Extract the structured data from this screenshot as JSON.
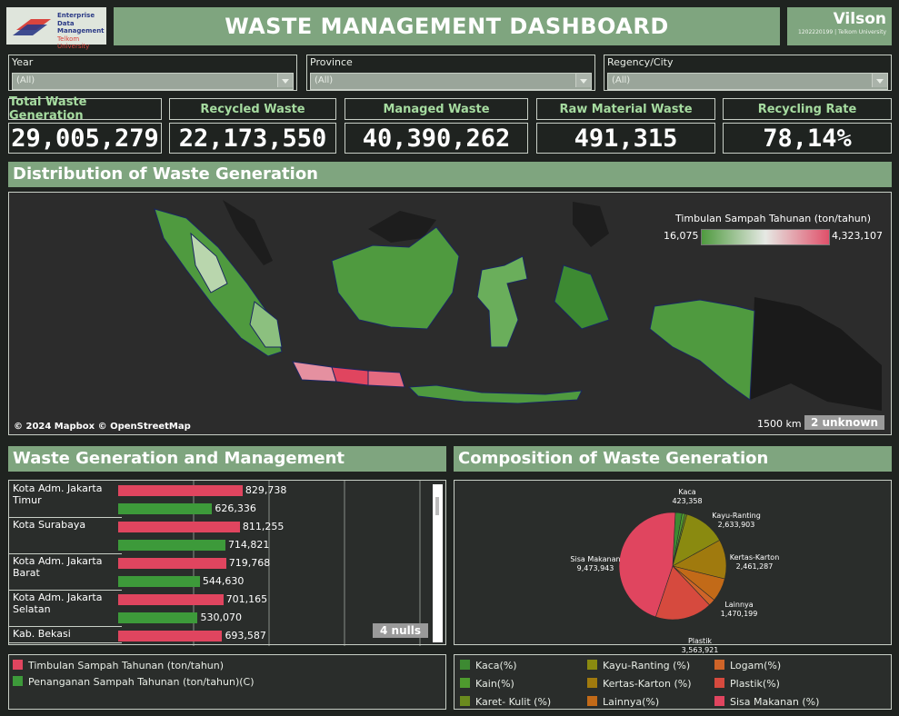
{
  "header": {
    "logo_lines": [
      "Enterprise",
      "Data",
      "Management"
    ],
    "logo_sub": "Telkom University",
    "title": "WASTE MANAGEMENT DASHBOARD",
    "user_name": "Vilson",
    "user_id": "1202220199 | Telkom University"
  },
  "filters": [
    {
      "label": "Year",
      "value": "(All)"
    },
    {
      "label": "Province",
      "value": "(All)"
    },
    {
      "label": "Regency/City",
      "value": "(All)"
    }
  ],
  "kpis": [
    {
      "label": "Total Waste Generation",
      "value": "29,005,279"
    },
    {
      "label": "Recycled Waste",
      "value": "22,173,550"
    },
    {
      "label": "Managed Waste",
      "value": "40,390,262"
    },
    {
      "label": "Raw Material Waste",
      "value": "491,315"
    },
    {
      "label": "Recycling Rate",
      "value": "78,14%"
    }
  ],
  "map_section": {
    "title": "Distribution of Waste Generation",
    "legend_title": "Timbulan Sampah Tahunan (ton/tahun)",
    "legend_min": "16,075",
    "legend_max": "4,323,107",
    "copyright": "© 2024 Mapbox © OpenStreetMap",
    "scale_label": "1500 km",
    "unknown_badge": "2 unknown",
    "colors": {
      "low": "#4f9a3f",
      "mid": "#e6e9e4",
      "high": "#e0506a"
    }
  },
  "bars_section": {
    "title": "Waste Generation and Management",
    "nulls_badge": "4 nulls",
    "legend": [
      {
        "label": "Timbulan Sampah Tahunan (ton/tahun)",
        "color": "#e0455f"
      },
      {
        "label": "Penanganan Sampah Tahunan (ton/tahun)(C)",
        "color": "#3d9a3a"
      }
    ]
  },
  "chart_data": [
    {
      "type": "bar",
      "categories": [
        "Kota Adm. Jakarta Timur",
        "Kota Surabaya",
        "Kota Adm. Jakarta Barat",
        "Kota Adm. Jakarta Selatan",
        "Kab. Bekasi"
      ],
      "series": [
        {
          "name": "Timbulan Sampah Tahunan (ton/tahun)",
          "values": [
            829738,
            811255,
            719768,
            701165,
            693587
          ],
          "labels": [
            "829,738",
            "811,255",
            "719,768",
            "701,165",
            "693,587"
          ]
        },
        {
          "name": "Penanganan Sampah Tahunan (ton/tahun)(C)",
          "values": [
            626336,
            714821,
            544630,
            530070,
            null
          ],
          "labels": [
            "626,336",
            "714,821",
            "544,630",
            "530,070",
            ""
          ]
        }
      ],
      "orientation": "horizontal"
    },
    {
      "type": "pie",
      "title": "Composition of Waste Generation",
      "slices": [
        {
          "name": "Kaca",
          "value": 423358,
          "label": "423,358",
          "color": "#3d8a32"
        },
        {
          "name": "Kain",
          "value": 180000,
          "label": "",
          "color": "#4e9a2e"
        },
        {
          "name": "Karet- Kulit",
          "value": 120000,
          "label": "",
          "color": "#6a8a1e"
        },
        {
          "name": "Kayu-Ranting",
          "value": 2633903,
          "label": "2,633,903",
          "color": "#8a8a10"
        },
        {
          "name": "Kertas-Karton",
          "value": 2461287,
          "label": "2,461,287",
          "color": "#a07a0e"
        },
        {
          "name": "Lainnya",
          "value": 1470199,
          "label": "1,470,199",
          "color": "#c26a18"
        },
        {
          "name": "Logam",
          "value": 420000,
          "label": "",
          "color": "#cf6428"
        },
        {
          "name": "Plastik",
          "value": 3563921,
          "label": "3,563,921",
          "color": "#d64a3e"
        },
        {
          "name": "Sisa Makanan",
          "value": 9473943,
          "label": "9,473,943",
          "color": "#e0455f"
        }
      ]
    }
  ],
  "pie_section": {
    "title": "Composition of Waste Generation",
    "legend": [
      {
        "label": "Kaca(%)",
        "color": "#3d8a32"
      },
      {
        "label": "Kayu-Ranting (%)",
        "color": "#8a8a10"
      },
      {
        "label": "Logam(%)",
        "color": "#cf6428"
      },
      {
        "label": "Kain(%)",
        "color": "#4e9a2e"
      },
      {
        "label": "Kertas-Karton (%)",
        "color": "#a07a0e"
      },
      {
        "label": "Plastik(%)",
        "color": "#d64a3e"
      },
      {
        "label": "Karet- Kulit (%)",
        "color": "#6a8a1e"
      },
      {
        "label": "Lainnya(%)",
        "color": "#c26a18"
      },
      {
        "label": "Sisa Makanan (%)",
        "color": "#e0455f"
      }
    ]
  }
}
